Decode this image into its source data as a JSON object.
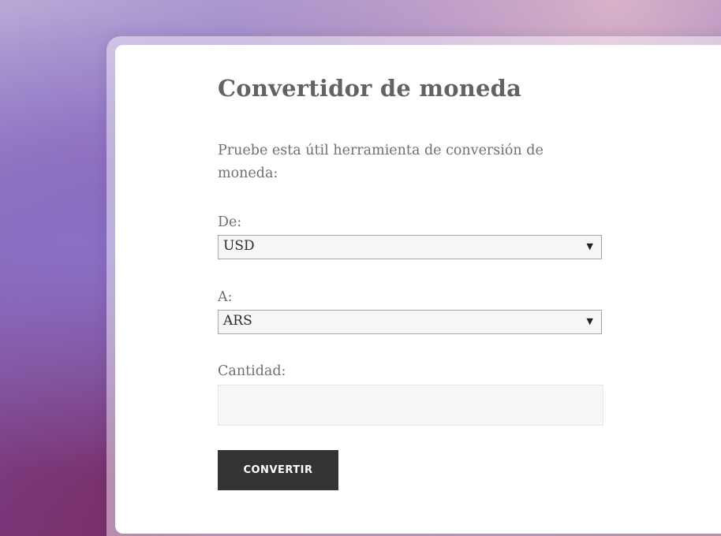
{
  "converter": {
    "title": "Convertidor de moneda",
    "intro": "Pruebe esta útil herramienta de conversión de moneda:",
    "from": {
      "label": "De:",
      "value": "USD",
      "arrow_icon": "triangle-down-icon"
    },
    "to": {
      "label": "A:",
      "value": "ARS",
      "arrow_icon": "triangle-down-icon"
    },
    "amount": {
      "label": "Cantidad:",
      "value": "",
      "placeholder": ""
    },
    "convert_label": "CONVERTIR"
  }
}
